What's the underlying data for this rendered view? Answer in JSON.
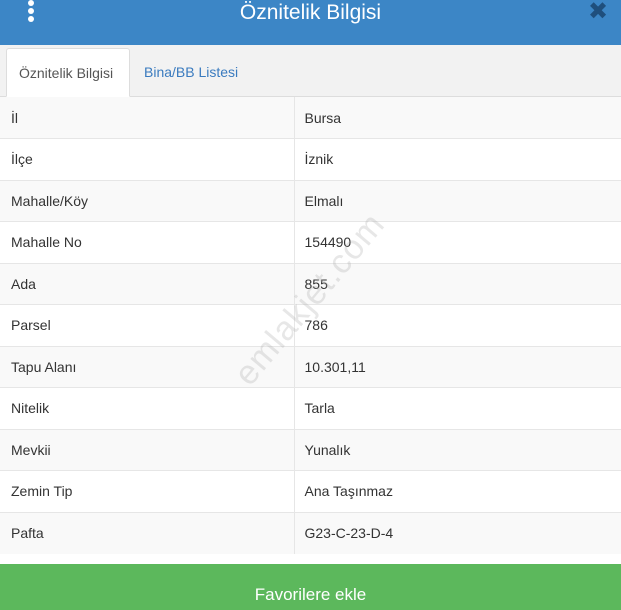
{
  "header": {
    "title": "Öznitelik Bilgisi",
    "menu_icon": "vertical-dots-icon",
    "close_icon": "close-icon",
    "close_glyph": "✖"
  },
  "tabs": [
    {
      "label": "Öznitelik Bilgisi",
      "active": true
    },
    {
      "label": "Bina/BB Listesi",
      "active": false
    }
  ],
  "rows": [
    {
      "key": "İl",
      "value": "Bursa"
    },
    {
      "key": "İlçe",
      "value": "İznik"
    },
    {
      "key": "Mahalle/Köy",
      "value": "Elmalı"
    },
    {
      "key": "Mahalle No",
      "value": "154490"
    },
    {
      "key": "Ada",
      "value": "855"
    },
    {
      "key": "Parsel",
      "value": "786"
    },
    {
      "key": "Tapu Alanı",
      "value": "10.301,11"
    },
    {
      "key": "Nitelik",
      "value": "Tarla"
    },
    {
      "key": "Mevkii",
      "value": "Yunalık"
    },
    {
      "key": "Zemin Tip",
      "value": "Ana Taşınmaz"
    },
    {
      "key": "Pafta",
      "value": "G23-C-23-D-4"
    }
  ],
  "watermark": "emlakjet.com",
  "footer": {
    "favorite_label": "Favorilere ekle"
  },
  "colors": {
    "header": "#3c86c6",
    "accent_link": "#3a7bbf",
    "button": "#5cb85c"
  }
}
